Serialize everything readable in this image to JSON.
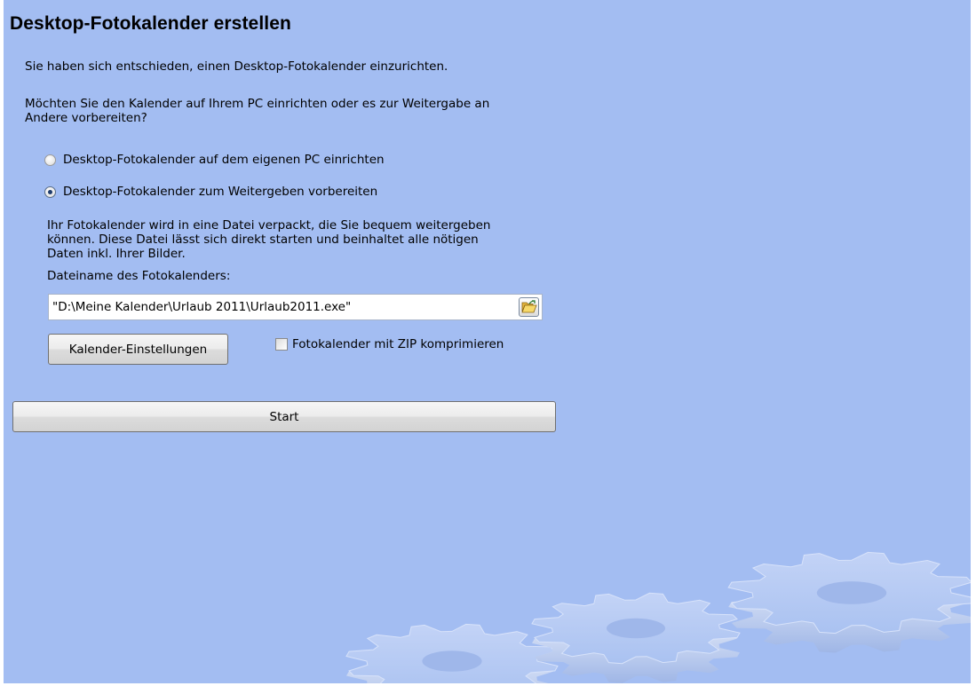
{
  "page": {
    "title": "Desktop-Fotokalender erstellen",
    "intro": "Sie haben sich entschieden, einen Desktop-Fotokalender einzurichten.",
    "question": " Möchten Sie den Kalender auf Ihrem PC einrichten oder es zur Weitergabe an\nAndere vorbereiten?"
  },
  "options": {
    "own_pc_label": "Desktop-Fotokalender auf dem eigenen PC einrichten",
    "own_pc_selected": false,
    "share_label": "Desktop-Fotokalender zum Weitergeben vorbereiten",
    "share_selected": true
  },
  "share": {
    "description": "Ihr Fotokalender wird in eine Datei verpackt, die Sie bequem weitergeben\nkönnen. Diese Datei lässt sich direkt starten und beinhaltet alle nötigen\nDaten inkl. Ihrer Bilder.",
    "filename_label": "Dateiname des Fotokalenders:",
    "filename_value": "\"D:\\Meine Kalender\\Urlaub 2011\\Urlaub2011.exe\"",
    "browse_icon": "folder-open-icon",
    "settings_button": "Kalender-Einstellungen",
    "zip_label": "Fotokalender mit ZIP komprimieren",
    "zip_checked": false
  },
  "actions": {
    "start_button": "Start"
  },
  "colors": {
    "background": "#a3bdf2",
    "gear": "#b6cbf5"
  }
}
